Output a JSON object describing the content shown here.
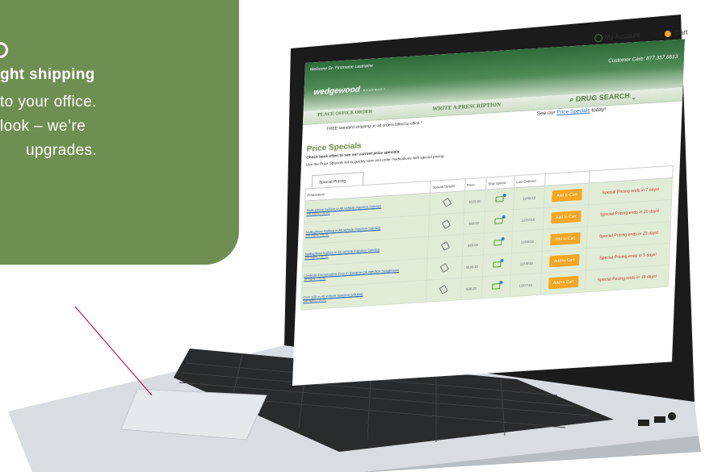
{
  "callout": {
    "bold_line": "ght shipping",
    "line2": "to your office.",
    "line3": "look – we’re",
    "line4": "upgrades."
  },
  "site": {
    "welcome": "Welcome Dr. Firstname Lastname",
    "my_account": "My Account",
    "cart": "Cart",
    "customer_care": "Customer Care: 877.357.6613",
    "logo": "wedgewood",
    "logo_small": "PHARMACY",
    "nav": {
      "place_order": "PLACE OFFICE ORDER",
      "write_rx": "WRITE A PRESCRIPTION",
      "drug_search": "DRUG SEARCH"
    },
    "shipping_note": "FREE standard shipping on all orders billed to office.*",
    "specials_prefix": "See our ",
    "specials_link": "Price Specials",
    "specials_suffix": " today!",
    "page_title": "Price Specials",
    "page_subtitle": "Check back often to see our current price specials",
    "page_desc": "Use the Price Specials list to quickly view and order medications with special pricing.",
    "tab": "Special Pricing",
    "table": {
      "headers": [
        "Preparation",
        "Special Details",
        "Price",
        "Ship Speed",
        "Last Ordered",
        "",
        ""
      ],
      "rows": [
        {
          "name": "Nalbuphine Sulfate in All vehicle Injection Solution",
          "detail": "100 mg/mL / 30 mL",
          "price": "$128.00",
          "date": "11/05/18",
          "button": "Add to Cart",
          "special": "Special Pricing ends in 7 days!"
        },
        {
          "name": "Nalbuphine Sulfate in All vehicle Injection Solution",
          "detail": "100 mg/mL / 30 mL",
          "price": "$60.00",
          "date": "11/07/18",
          "button": "Add to Cart",
          "special": "Special Pricing ends in 20 days!"
        },
        {
          "name": "Nalbuphine Sulfate in All vehicle Injection Solution",
          "detail": "100 mg/mL / 30 mL",
          "price": "$68.00",
          "date": "11/06/18",
          "button": "Add to Cart",
          "special": "Special Pricing ends in 23 days!"
        },
        {
          "name": "Clodrolin Preservative Free in Sesame Oil Injection Suspension",
          "detail": "10 mg/mL / 30 mL",
          "price": "$106.20",
          "date": "11/05/18",
          "button": "Add to Cart",
          "special": "Special Pricing ends in 5 days!"
        },
        {
          "name": "DSS 180 in All vehicle Injection Solution",
          "detail": "100 mg/mL / 30 mL",
          "price": "$36.20",
          "date": "11/07/18",
          "button": "Add to Cart",
          "special": "Special Pricing ends in 19 days!"
        }
      ]
    }
  }
}
